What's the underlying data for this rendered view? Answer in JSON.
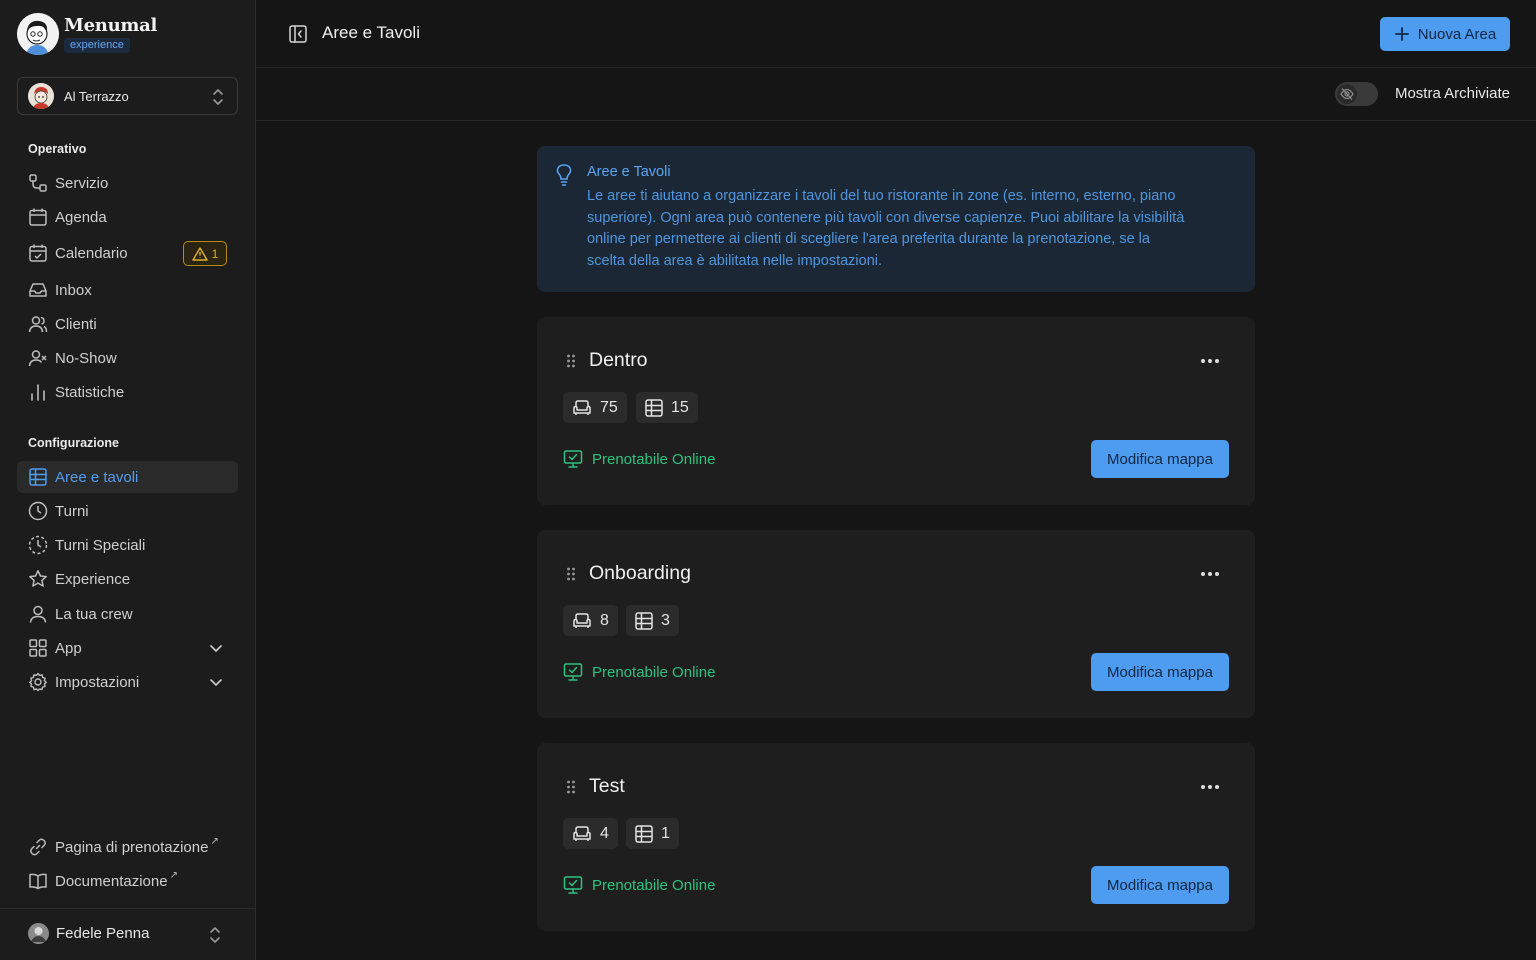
{
  "brand": {
    "name": "Menumal",
    "tag": "experience"
  },
  "venue": {
    "name": "Al Terrazzo"
  },
  "sidebar": {
    "operativo_title": "Operativo",
    "operativo": [
      {
        "label": "Servizio",
        "icon": "route-icon"
      },
      {
        "label": "Agenda",
        "icon": "calendar-icon"
      },
      {
        "label": "Calendario",
        "icon": "calendar-check-icon",
        "badge": "1"
      },
      {
        "label": "Inbox",
        "icon": "inbox-icon"
      },
      {
        "label": "Clienti",
        "icon": "users-icon"
      },
      {
        "label": "No-Show",
        "icon": "user-x-icon"
      },
      {
        "label": "Statistiche",
        "icon": "bar-chart-icon"
      }
    ],
    "config_title": "Configurazione",
    "config": [
      {
        "label": "Aree e tavoli",
        "icon": "table-grid-icon",
        "active": true
      },
      {
        "label": "Turni",
        "icon": "clock-icon"
      },
      {
        "label": "Turni Speciali",
        "icon": "clock-dashed-icon"
      },
      {
        "label": "Experience",
        "icon": "star-icon"
      },
      {
        "label": "La tua crew",
        "icon": "user-icon"
      },
      {
        "label": "App",
        "icon": "apps-grid-icon"
      },
      {
        "label": "Impostazioni",
        "icon": "gear-icon"
      }
    ],
    "links": [
      {
        "label": "Pagina di prenotazione",
        "icon": "link-icon"
      },
      {
        "label": "Documentazione",
        "icon": "book-icon"
      }
    ],
    "user": {
      "name": "Fedele Penna"
    }
  },
  "header": {
    "title": "Aree e Tavoli",
    "new_button": "Nuova Area"
  },
  "subbar": {
    "toggle_label": "Mostra Archiviate",
    "toggle_on": false
  },
  "info": {
    "title": "Aree e Tavoli",
    "lines": [
      "Le aree ti aiutano a organizzare i tavoli del tuo ristorante in zone (es. interno, esterno, piano",
      "superiore). Ogni area può contenere più tavoli con diverse capienze. Puoi abilitare la visibilità",
      "online per permettere ai clienti di scegliere l'area preferita durante la prenotazione, se la",
      "scelta della area è abilitata nelle impostazioni."
    ]
  },
  "areas": [
    {
      "name": "Dentro",
      "seats": "75",
      "tables": "15",
      "online_label": "Prenotabile Online",
      "edit_label": "Modifica mappa"
    },
    {
      "name": "Onboarding",
      "seats": "8",
      "tables": "3",
      "online_label": "Prenotabile Online",
      "edit_label": "Modifica mappa"
    },
    {
      "name": "Test",
      "seats": "4",
      "tables": "1",
      "online_label": "Prenotabile Online",
      "edit_label": "Modifica mappa"
    }
  ],
  "colors": {
    "accent": "#4d9cf0",
    "success": "#2ec27e",
    "warning": "#e0b12a",
    "background": "#151515",
    "card": "#1e1e1e",
    "info_bg": "#1c2735"
  }
}
